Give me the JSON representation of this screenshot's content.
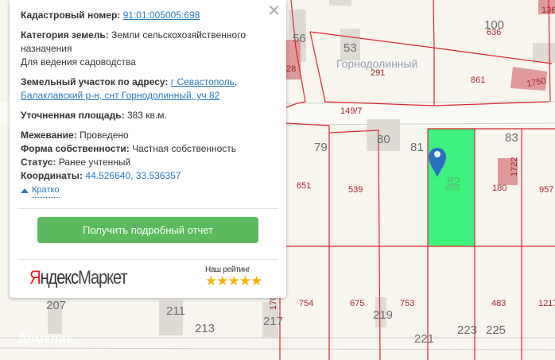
{
  "popup": {
    "close_icon": "close-icon",
    "cadastral_label": "Кадастровый номер:",
    "cadastral_value": "91:01:005005:698",
    "category_label": "Категория земель:",
    "category_value_1": "Земли сельскохозяйственного",
    "category_value_2": "назначения",
    "usage": "Для ведения садоводства",
    "address_label": "Земельный участок по адресу:",
    "address_value_1": "г Севастополь,",
    "address_value_2": "Балаклавский р-н, снт Горнодолинный, уч 82",
    "area_label": "Уточненная площадь:",
    "area_value": "383 кв.м.",
    "survey_label": "Межевание:",
    "survey_value": "Проведено",
    "ownership_label": "Форма собственности:",
    "ownership_value": "Частная собственность",
    "status_label": "Статус:",
    "status_value": "Ранее учтенный",
    "coords_label": "Координаты:",
    "coords_value": "44.526640, 33.536357",
    "toggle_label": "Кратко",
    "report_button": "Получить подробный отчет",
    "logo_red": "Я",
    "logo_rest": "ндекс",
    "logo_market": "Маркет",
    "rating_label": "Наш рейтинг",
    "rating_stars": "★★★★★",
    "rating_value": 5
  },
  "map": {
    "watermark": "Домклик",
    "street": "Горнодолинный",
    "labels": [
      "56",
      "53",
      "100",
      "636",
      "291",
      "861",
      "1750",
      "136",
      "149/7",
      "79",
      "80",
      "81",
      "83",
      "82",
      "698",
      "651",
      "539",
      "180",
      "957",
      "1722",
      "754",
      "675",
      "753",
      "483",
      "1217",
      "207",
      "211",
      "213",
      "217",
      "219",
      "221",
      "223",
      "225",
      "170",
      "28"
    ],
    "colors": {
      "parcel_line": "#d9262c",
      "selected_parcel": "#3ff27d",
      "pin": "#2b6fc2",
      "button": "#5cb85c"
    }
  }
}
